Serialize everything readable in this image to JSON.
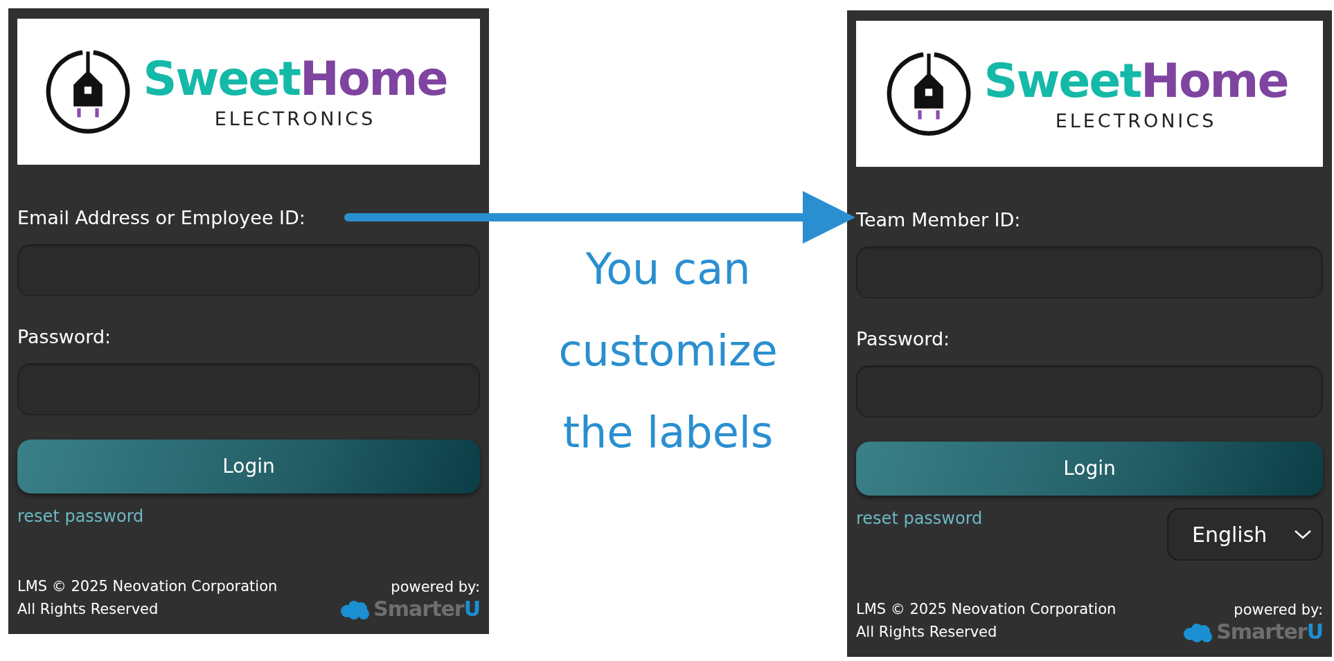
{
  "panels": [
    {
      "logo": {
        "brand_parts": [
          {
            "text": "Sweet",
            "color": "#14b9a8"
          },
          {
            "text": "Home",
            "color": "#7e44a0"
          }
        ],
        "tagline": "ELECTRONICS"
      },
      "fields": [
        {
          "label": "Email Address or Employee ID:"
        },
        {
          "label": "Password:"
        }
      ],
      "login_button": "Login",
      "reset_link": "reset password",
      "footer": {
        "copyright": "LMS © 2025 Neovation Corporation",
        "rights": "All Rights Reserved",
        "powered_by": "powered by:",
        "brand_parts": [
          {
            "text": "Smarter",
            "color": "#6e6e6e"
          },
          {
            "text": "U",
            "color": "#1b8fd2"
          }
        ]
      }
    },
    {
      "logo": {
        "brand_parts": [
          {
            "text": "Sweet",
            "color": "#14b9a8"
          },
          {
            "text": "Home",
            "color": "#7e44a0"
          }
        ],
        "tagline": "ELECTRONICS"
      },
      "fields": [
        {
          "label": "Team Member ID:"
        },
        {
          "label": "Password:"
        }
      ],
      "login_button": "Login",
      "reset_link": "reset password",
      "language": "English",
      "footer": {
        "copyright": "LMS © 2025 Neovation Corporation",
        "rights": "All Rights Reserved",
        "powered_by": "powered by:",
        "brand_parts": [
          {
            "text": "Smarter",
            "color": "#6e6e6e"
          },
          {
            "text": "U",
            "color": "#1b8fd2"
          }
        ]
      }
    }
  ],
  "caption": [
    "You can",
    "customize",
    "the labels"
  ]
}
